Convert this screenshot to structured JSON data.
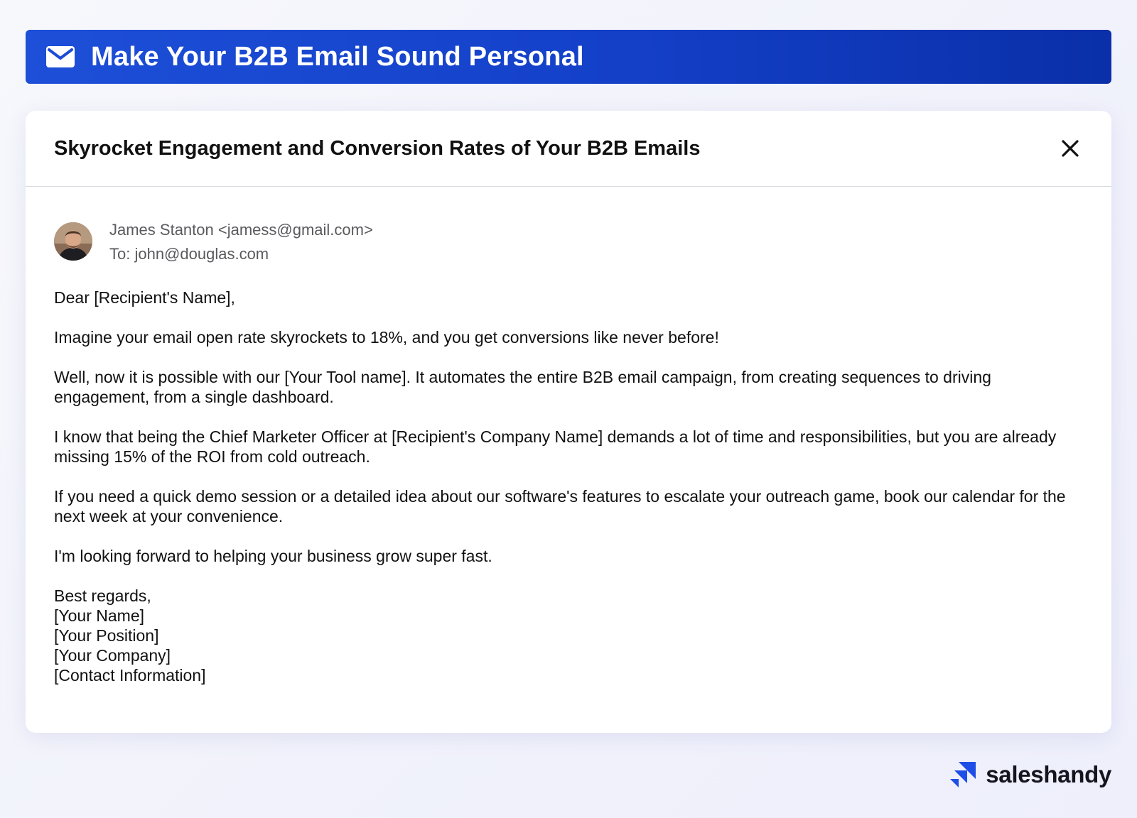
{
  "banner": {
    "icon": "envelope-icon",
    "title": "Make Your B2B Email Sound Personal"
  },
  "card": {
    "title": "Skyrocket Engagement and Conversion Rates of Your B2B Emails",
    "close_icon": "close-icon"
  },
  "email": {
    "from": "James Stanton <jamess@gmail.com>",
    "to": "To: john@douglas.com",
    "greeting": "Dear [Recipient's Name],",
    "paragraphs": [
      "Imagine your email open rate skyrockets to 18%, and you get conversions like never before!",
      "Well, now it is possible with our [Your Tool name]. It automates the entire B2B email campaign, from creating sequences to driving engagement, from a single dashboard.",
      "I know that being the Chief Marketer Officer at [Recipient's Company Name] demands a lot of time and responsibilities, but you are already missing 15% of the ROI from cold outreach.",
      "If you need a quick demo session or a detailed idea about our software's features to escalate your outreach game, book our calendar for the next week at your convenience.",
      "I'm looking forward to helping your business grow super fast."
    ],
    "signature": [
      "Best regards,",
      "[Your Name]",
      "[Your Position]",
      "[Your Company]",
      "[Contact Information]"
    ]
  },
  "brand": {
    "name": "saleshandy",
    "logo_icon": "saleshandy-logo-icon"
  },
  "colors": {
    "banner_start": "#1d4fd8",
    "banner_end": "#0a2fa8",
    "brand_blue": "#1f4ee6"
  }
}
